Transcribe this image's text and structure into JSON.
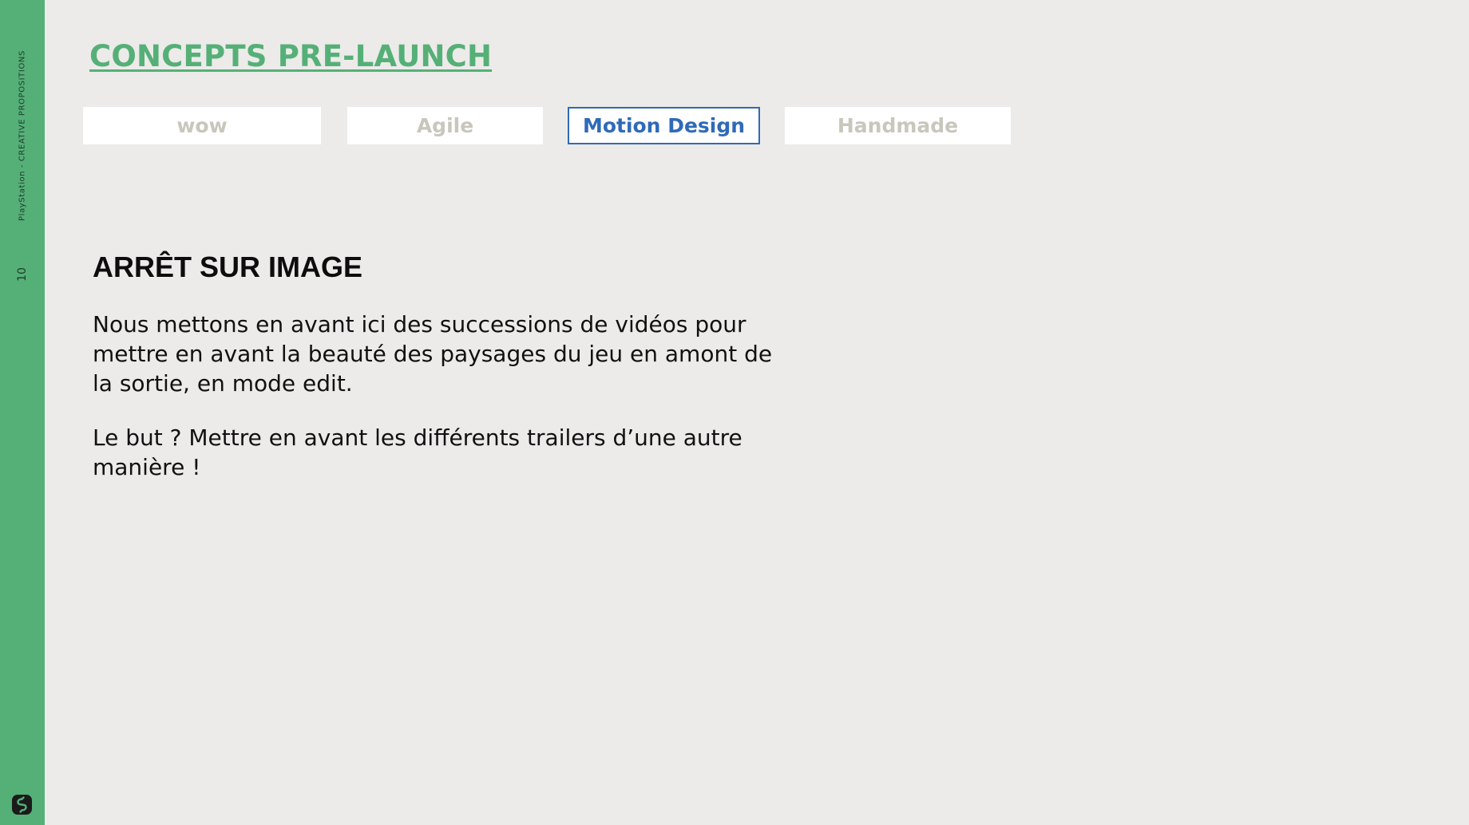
{
  "sidebar": {
    "vertical_text": "PlayStation - CREATIVE PROPOSITIONS",
    "page_number": "10",
    "logo_icon": "swirl-logo-icon"
  },
  "title": "CONCEPTS PRE-LAUNCH",
  "tabs": [
    {
      "label": "wow",
      "active": false
    },
    {
      "label": "Agile",
      "active": false
    },
    {
      "label": "Motion Design",
      "active": true
    },
    {
      "label": "Handmade",
      "active": false
    }
  ],
  "content": {
    "heading": "ARRÊT SUR IMAGE",
    "paragraph_1": "Nous mettons en avant ici des successions de vidéos pour mettre en avant la beauté des paysages du jeu en amont de la sortie, en mode edit.",
    "paragraph_2": "Le but ? Mettre en avant les différents trailers d’une autre manière !"
  },
  "colors": {
    "accent_green": "#55b077",
    "active_blue": "#2f6ab8",
    "inactive_tab_text": "#c9c6bc",
    "background": "#ecebe9"
  }
}
